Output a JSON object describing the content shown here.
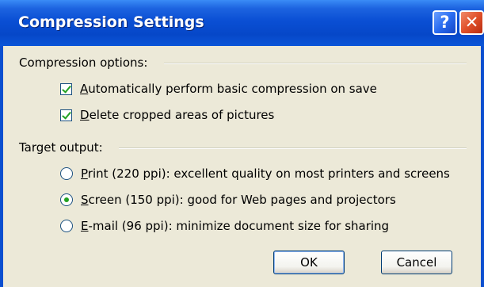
{
  "dialog": {
    "title": "Compression Settings",
    "help_label": "?",
    "close_label": "✕"
  },
  "compression_options": {
    "label": "Compression options:",
    "items": [
      {
        "access_key": "A",
        "rest": "utomatically perform basic compression on save",
        "checked": true
      },
      {
        "access_key": "D",
        "rest": "elete cropped areas of pictures",
        "checked": true
      }
    ]
  },
  "target_output": {
    "label": "Target output:",
    "options": [
      {
        "access_key": "P",
        "rest": "rint (220 ppi): excellent quality on most printers and screens",
        "selected": false
      },
      {
        "access_key": "S",
        "rest": "creen (150 ppi): good for Web pages and projectors",
        "selected": true
      },
      {
        "access_key": "E",
        "rest": "-mail (96 ppi): minimize document size for sharing",
        "selected": false
      }
    ]
  },
  "buttons": {
    "ok": "OK",
    "cancel": "Cancel"
  },
  "colors": {
    "title_bar": "#0a4fd4",
    "dialog_bg": "#ece9d8",
    "check_mark": "#21a121",
    "close_button": "#e0502a"
  }
}
